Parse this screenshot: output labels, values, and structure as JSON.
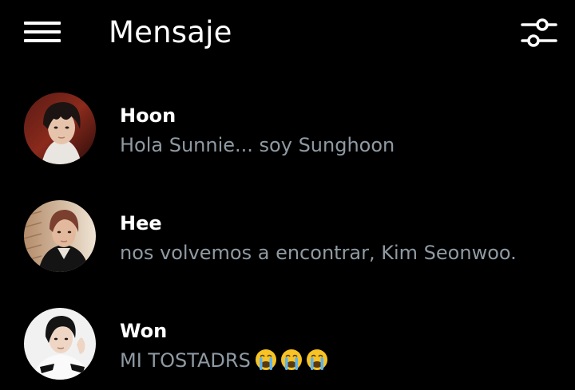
{
  "header": {
    "title": "Mensaje",
    "menu_icon": "hamburger-menu-icon",
    "filter_icon": "sliders-filter-icon"
  },
  "chats": [
    {
      "name": "Hoon",
      "preview": "Hola Sunnie... soy Sunghoon",
      "emoji_count": 0
    },
    {
      "name": "Hee",
      "preview": "nos volvemos a encontrar, Kim Seonwoo.",
      "emoji_count": 0
    },
    {
      "name": "Won",
      "preview": "MI TOSTADRS",
      "emoji": "😭",
      "emoji_count": 3
    }
  ],
  "colors": {
    "background": "#000000",
    "title": "#ffffff",
    "name": "#ffffff",
    "preview": "#8f9aa3",
    "emoji": "#f7c325"
  }
}
